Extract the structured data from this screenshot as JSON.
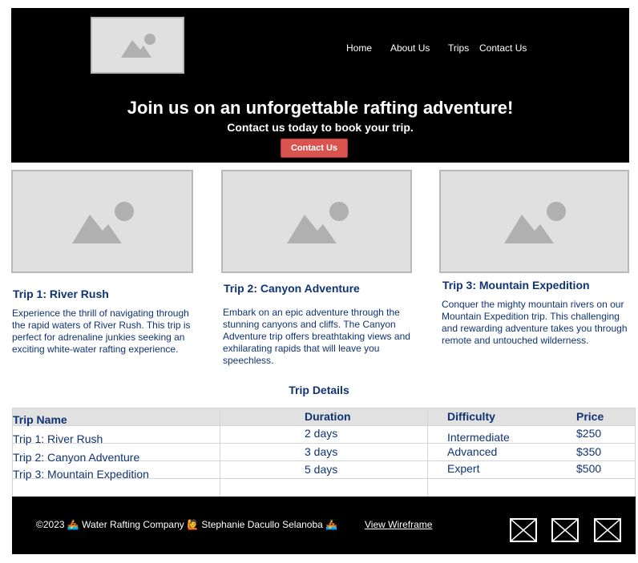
{
  "header": {
    "nav": [
      "Home",
      "About Us",
      "Trips",
      "Contact Us"
    ],
    "hero_title": "Join us on an unforgettable rafting adventure!",
    "hero_subtitle": "Contact us today to book your trip.",
    "hero_button": "Contact Us"
  },
  "trips": [
    {
      "title": "Trip 1: River Rush",
      "description": "Experience the thrill of navigating through the rapid waters of River Rush. This trip is perfect for adrenaline junkies seeking an exciting white-water rafting experience."
    },
    {
      "title": "Trip 2: Canyon Adventure",
      "description": "Embark on an epic adventure through the stunning canyons and cliffs. The Canyon Adventure trip offers breathtaking views and exhilarating rapids that will leave you speechless."
    },
    {
      "title": "Trip 3: Mountain Expedition",
      "description": "Conquer the mighty mountain rivers on our Mountain Expedition trip. This challenging and rewarding adventure takes you through remote and untouched wilderness."
    }
  ],
  "details": {
    "title": "Trip Details",
    "headers": [
      "Trip Name",
      "Duration",
      "Difficulty",
      "Price"
    ],
    "rows": [
      [
        "Trip 1: River Rush",
        "2 days",
        "Intermediate",
        "$250"
      ],
      [
        "Trip 2: Canyon Adventure",
        "3 days",
        "Advanced",
        "$350"
      ],
      [
        "Trip 3: Mountain Expedition",
        "5 days",
        "Expert",
        "$500"
      ]
    ]
  },
  "footer": {
    "copyright": "©2023 🚣 Water Rafting Company 🙋 Stephanie Dacullo Selanoba 🚣",
    "link": "View Wireframe",
    "social_icons": [
      "placeholder-icon",
      "placeholder-icon",
      "placeholder-icon"
    ]
  },
  "colors": {
    "header_bg": "#000000",
    "accent_button": "#d9534f",
    "text_blue": "#103373"
  }
}
